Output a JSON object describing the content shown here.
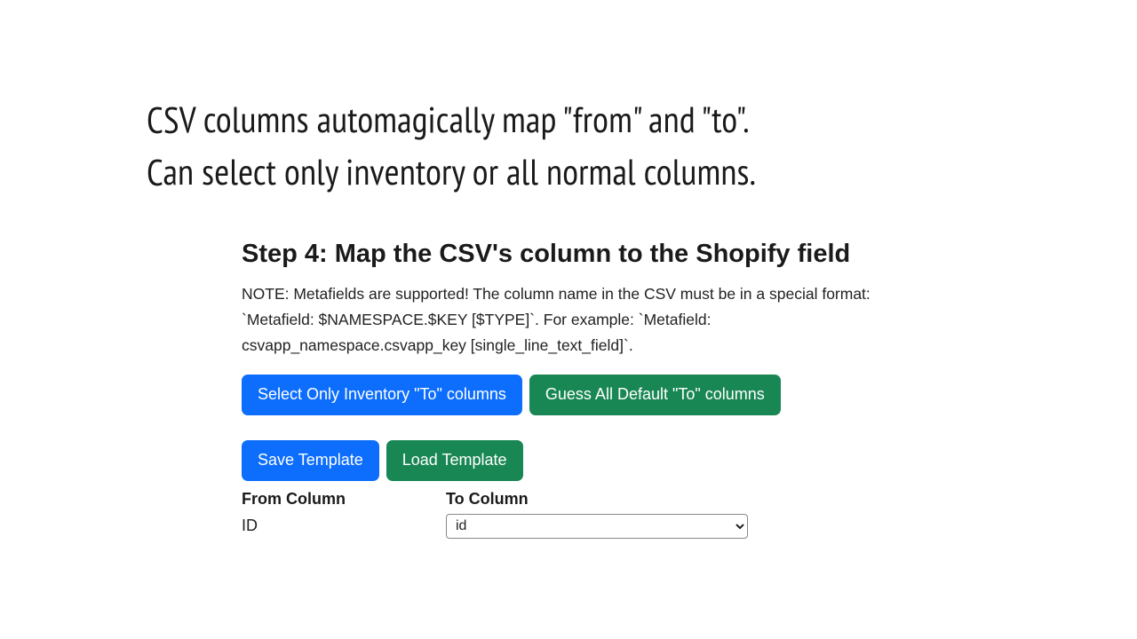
{
  "headline_line1": "CSV columns automagically map \"from\" and \"to\".",
  "headline_line2": "Can select only inventory or all normal columns.",
  "step_heading": "Step 4: Map the CSV's column to the Shopify field",
  "note_text": "NOTE: Metafields are supported! The column name in the CSV must be in a special format: `Metafield: $NAMESPACE.$KEY [$TYPE]`. For example: `Metafield: csvapp_namespace.csvapp_key [single_line_text_field]`.",
  "buttons": {
    "select_inventory": "Select Only Inventory \"To\" columns",
    "guess_default": "Guess All Default \"To\" columns",
    "save_template": "Save Template",
    "load_template": "Load Template"
  },
  "table": {
    "from_header": "From Column",
    "to_header": "To Column",
    "rows": [
      {
        "from": "ID",
        "to": "id"
      }
    ]
  }
}
